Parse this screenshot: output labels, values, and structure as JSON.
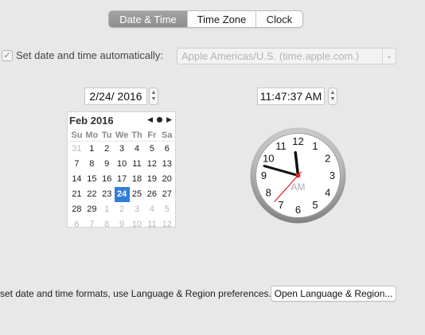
{
  "tabs": [
    {
      "label": "Date & Time",
      "active": true
    },
    {
      "label": "Time Zone",
      "active": false
    },
    {
      "label": "Clock",
      "active": false
    }
  ],
  "auto": {
    "checked": true,
    "label": "Set date and time automatically:",
    "server": "Apple Americas/U.S. (time.apple.com.)"
  },
  "date_field": {
    "value": "2/24/ 2016"
  },
  "time_field": {
    "value": "11:47:37 AM"
  },
  "calendar": {
    "month_label": "Feb 2016",
    "weekdays": [
      "Su",
      "Mo",
      "Tu",
      "We",
      "Th",
      "Fr",
      "Sa"
    ],
    "days": [
      {
        "d": "31",
        "other": true
      },
      {
        "d": "1"
      },
      {
        "d": "2"
      },
      {
        "d": "3"
      },
      {
        "d": "4"
      },
      {
        "d": "5"
      },
      {
        "d": "6"
      },
      {
        "d": "7"
      },
      {
        "d": "8"
      },
      {
        "d": "9"
      },
      {
        "d": "10"
      },
      {
        "d": "11"
      },
      {
        "d": "12"
      },
      {
        "d": "13"
      },
      {
        "d": "14"
      },
      {
        "d": "15"
      },
      {
        "d": "16"
      },
      {
        "d": "17"
      },
      {
        "d": "18"
      },
      {
        "d": "19"
      },
      {
        "d": "20"
      },
      {
        "d": "21"
      },
      {
        "d": "22"
      },
      {
        "d": "23"
      },
      {
        "d": "24",
        "selected": true
      },
      {
        "d": "25"
      },
      {
        "d": "26"
      },
      {
        "d": "27"
      },
      {
        "d": "28"
      },
      {
        "d": "29"
      },
      {
        "d": "1",
        "other": true
      },
      {
        "d": "2",
        "other": true
      },
      {
        "d": "3",
        "other": true
      },
      {
        "d": "4",
        "other": true
      },
      {
        "d": "5",
        "other": true
      },
      {
        "d": "6",
        "other": true
      },
      {
        "d": "7",
        "other": true
      },
      {
        "d": "8",
        "other": true
      },
      {
        "d": "9",
        "other": true
      },
      {
        "d": "10",
        "other": true
      },
      {
        "d": "11",
        "other": true
      },
      {
        "d": "12",
        "other": true
      }
    ],
    "accent": "#2e7fd8"
  },
  "clock": {
    "numbers": [
      "12",
      "1",
      "2",
      "3",
      "4",
      "5",
      "6",
      "7",
      "8",
      "9",
      "10",
      "11"
    ],
    "period": "AM",
    "time": {
      "hours": 11,
      "minutes": 47,
      "seconds": 37
    },
    "second_hand_color": "#d8252b"
  },
  "footer": {
    "text": "set date and time formats, use Language & Region preferences.",
    "button_label": "Open Language & Region..."
  }
}
